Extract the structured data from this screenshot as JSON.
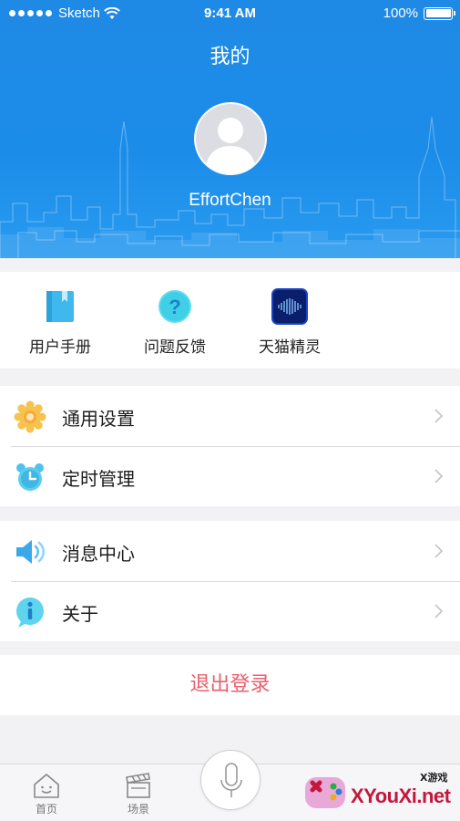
{
  "status_bar": {
    "carrier": "Sketch",
    "time": "9:41 AM",
    "battery": "100%"
  },
  "header": {
    "title": "我的",
    "username": "EffortChen"
  },
  "tools": [
    {
      "label": "用户手册",
      "icon": "book-icon"
    },
    {
      "label": "问题反馈",
      "icon": "question-icon"
    },
    {
      "label": "天猫精灵",
      "icon": "tmall-genie-icon"
    }
  ],
  "menu_group_1": [
    {
      "label": "通用设置",
      "icon": "gear-icon"
    },
    {
      "label": "定时管理",
      "icon": "alarm-clock-icon"
    }
  ],
  "menu_group_2": [
    {
      "label": "消息中心",
      "icon": "speaker-icon"
    },
    {
      "label": "关于",
      "icon": "info-icon"
    }
  ],
  "logout_label": "退出登录",
  "tabbar": {
    "home": "首页",
    "scenes": "场景"
  },
  "watermark": {
    "text": "XYouXi.net",
    "small": "X游戏"
  },
  "colors": {
    "header_blue": "#1b8de9",
    "logout_red": "#e8606e"
  }
}
